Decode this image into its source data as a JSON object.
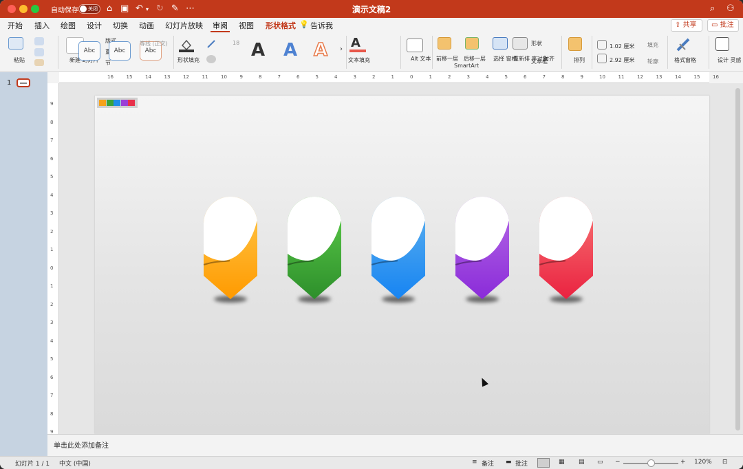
{
  "titlebar": {
    "autosave_label": "自动保存",
    "autosave_state": "关闭",
    "doc_title": "演示文稿2"
  },
  "tabs": [
    {
      "label": "开始"
    },
    {
      "label": "插入"
    },
    {
      "label": "绘图"
    },
    {
      "label": "设计"
    },
    {
      "label": "切换"
    },
    {
      "label": "动画"
    },
    {
      "label": "幻灯片放映"
    },
    {
      "label": "审阅"
    },
    {
      "label": "视图"
    },
    {
      "label": "形状格式"
    },
    {
      "label": "告诉我"
    }
  ],
  "share": {
    "share_label": "共享",
    "comment_label": "批注"
  },
  "ribbon": {
    "paste": "粘贴",
    "new_slide": "新建\n幻灯片",
    "layout": "版式",
    "reset": "重置",
    "section": "节",
    "style_preview": "Abc",
    "font_name": "等线 (正文)",
    "font_size": "18",
    "shape_fill": "形状填充",
    "text_fill": "文本填充",
    "alt_text": "Alt\n文本",
    "bring_forward": "前移一层",
    "send_backward": "后移一层",
    "smartart": "SmartArt",
    "selection_pane": "选择\n窗格",
    "reorder": "重新排\n序对象",
    "textbox": "文本框",
    "shape": "形状",
    "align": "对齐",
    "arrange": "排列",
    "height": "1.02 厘米",
    "width": "2.92 厘米",
    "fill": "填充",
    "outline": "轮廓",
    "format_pane": "格式窗格",
    "design_ideas": "设计\n灵感"
  },
  "thumbnails": {
    "slide_number": "1"
  },
  "ruler_h": [
    "16",
    "15",
    "14",
    "13",
    "12",
    "11",
    "10",
    "9",
    "8",
    "7",
    "6",
    "5",
    "4",
    "3",
    "2",
    "1",
    "0",
    "1",
    "2",
    "3",
    "4",
    "5",
    "6",
    "7",
    "8",
    "9",
    "10",
    "11",
    "12",
    "13",
    "14",
    "15",
    "16"
  ],
  "ruler_v": [
    "9",
    "8",
    "7",
    "6",
    "5",
    "4",
    "3",
    "2",
    "1",
    "0",
    "1",
    "2",
    "3",
    "4",
    "5",
    "6",
    "7",
    "8",
    "9"
  ],
  "slide": {
    "swatch_colors": [
      "#f6a21a",
      "#3ba33b",
      "#1f8ee8",
      "#9b3fd6",
      "#e8304a"
    ],
    "markers": [
      {
        "name": "orange",
        "top": "#ffc94d",
        "bottom": "#ff9a00"
      },
      {
        "name": "green",
        "top": "#5fcf4b",
        "bottom": "#2d8f2b"
      },
      {
        "name": "blue",
        "top": "#63b4ee",
        "bottom": "#1684f2"
      },
      {
        "name": "purple",
        "top": "#b86ee6",
        "bottom": "#8a2bd9"
      },
      {
        "name": "red",
        "top": "#f87b78",
        "bottom": "#ea2240"
      }
    ]
  },
  "notes": {
    "placeholder": "单击此处添加备注"
  },
  "status": {
    "slide_info": "幻灯片 1 / 1",
    "language": "中文 (中国)",
    "notes_label": "备注",
    "comments_label": "批注",
    "zoom": "120%"
  }
}
